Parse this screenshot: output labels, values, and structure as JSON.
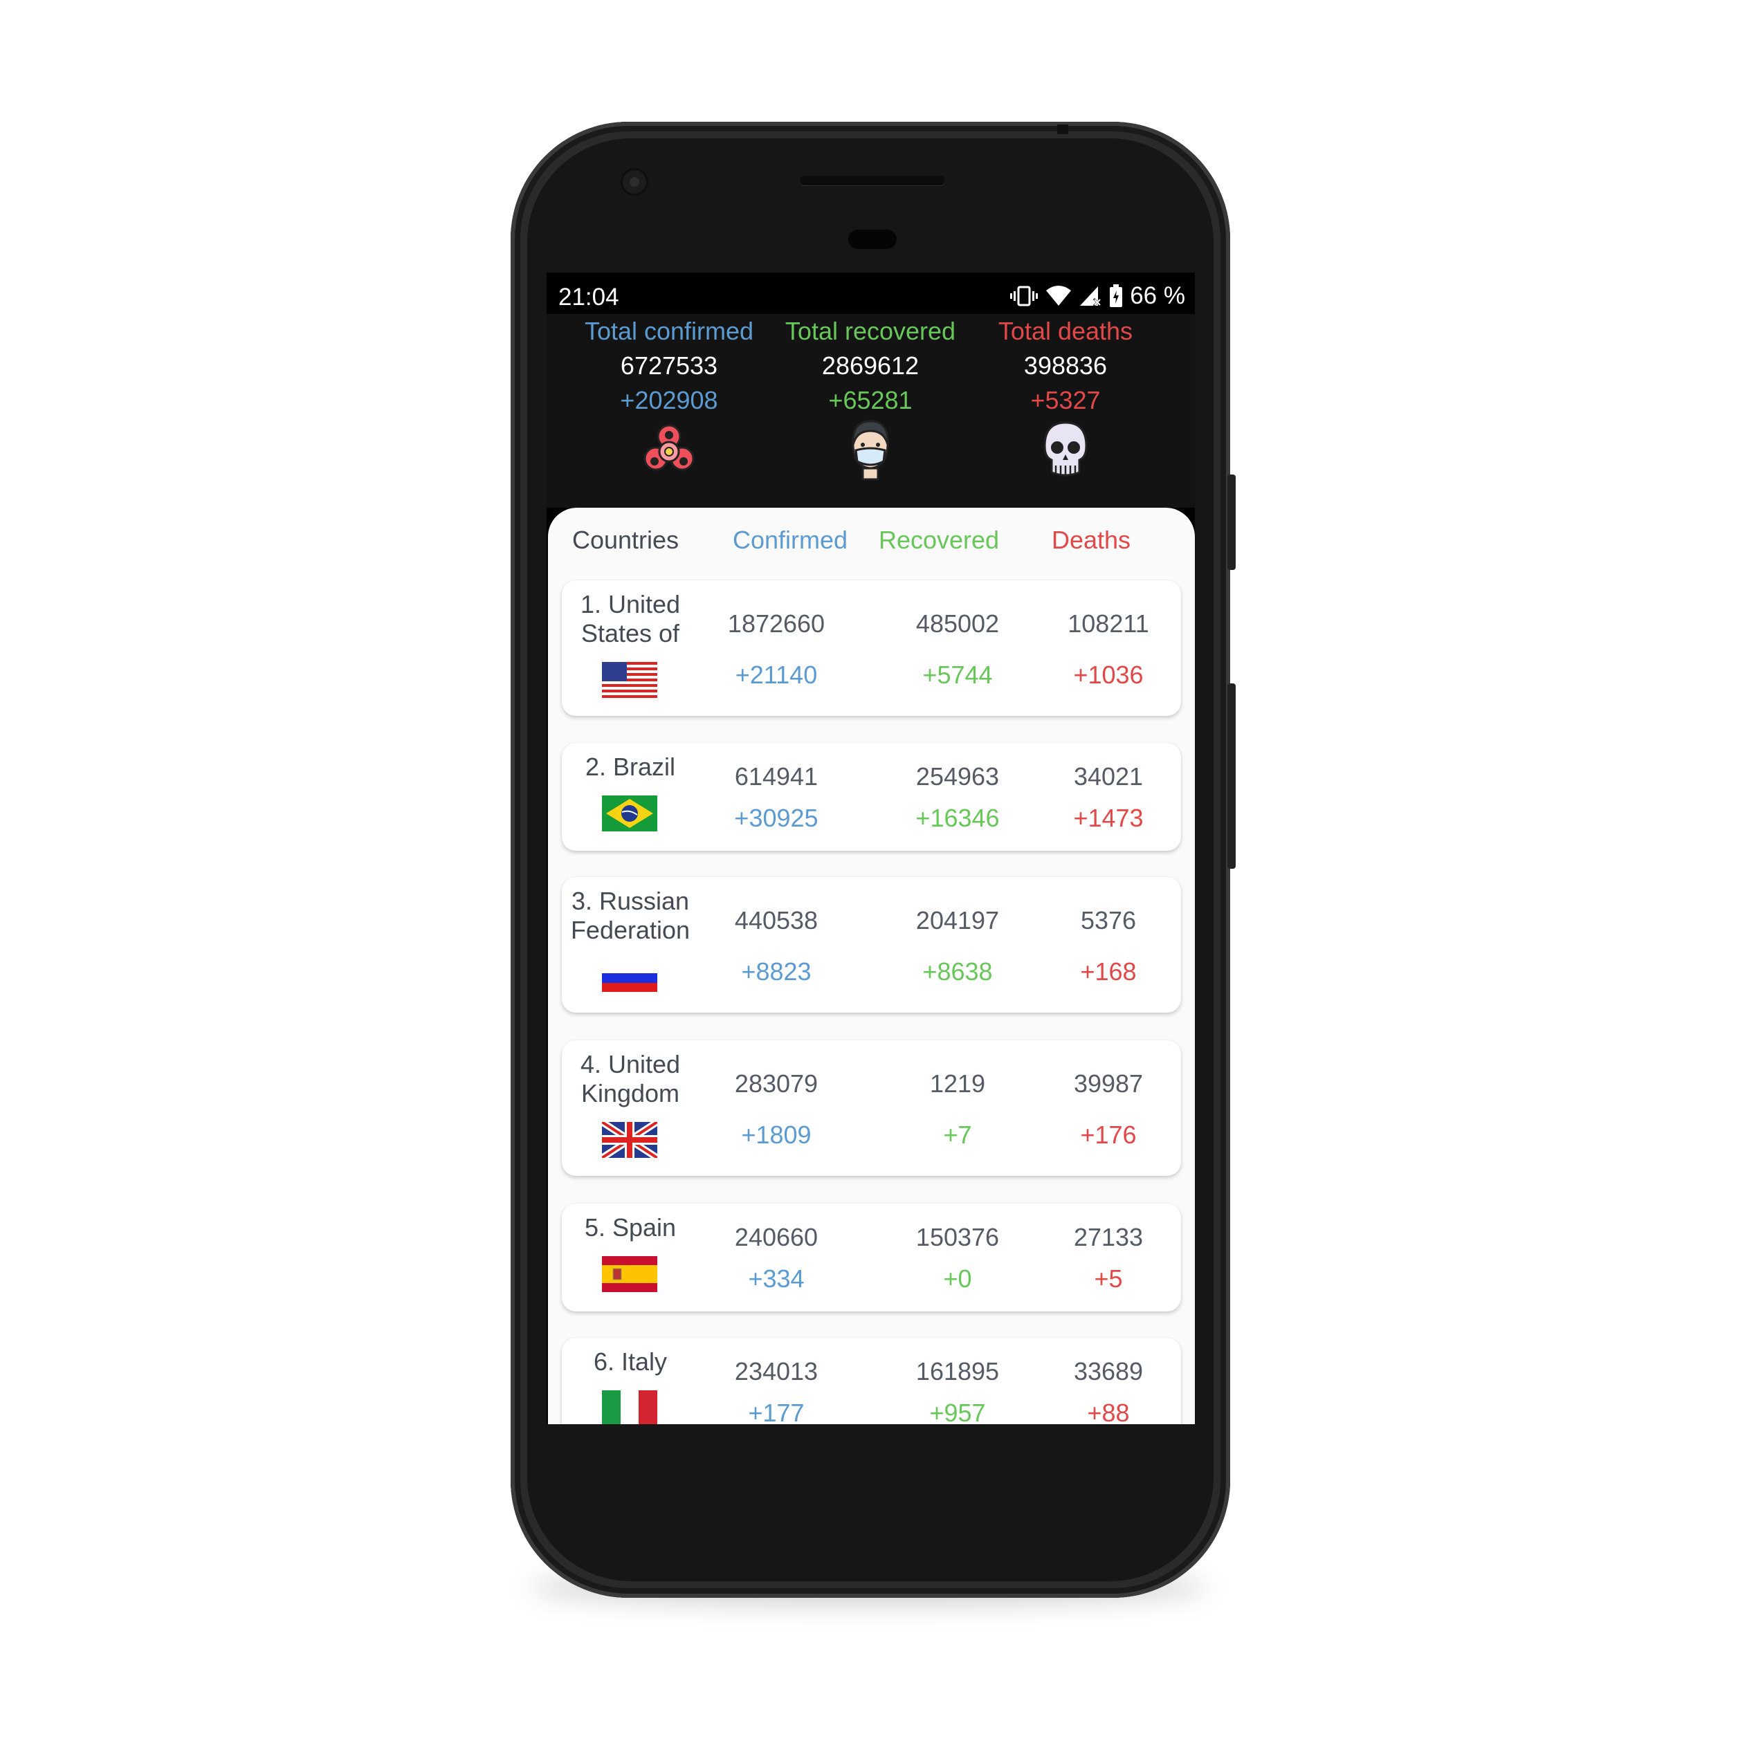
{
  "colors": {
    "confirmed": "#5c9bd1",
    "recovered": "#67c759",
    "deaths": "#e34848",
    "text": "#555b64"
  },
  "status_bar": {
    "time": "21:04",
    "battery": "66 %",
    "icons": [
      "vibrate-icon",
      "wifi-icon",
      "signal-icon",
      "battery-icon"
    ]
  },
  "summary": {
    "confirmed": {
      "label": "Total confirmed",
      "value": "6727533",
      "delta": "+202908",
      "icon": "biohazard-icon"
    },
    "recovered": {
      "label": "Total recovered",
      "value": "2869612",
      "delta": "+65281",
      "icon": "masked-person-icon"
    },
    "deaths": {
      "label": "Total deaths",
      "value": "398836",
      "delta": "+5327",
      "icon": "skull-icon"
    }
  },
  "table": {
    "headers": {
      "countries": "Countries",
      "confirmed": "Confirmed",
      "recovered": "Recovered",
      "deaths": "Deaths"
    },
    "rows": [
      {
        "name_l1": "1. United",
        "name_l2": "States of",
        "flag": "us-flag-icon",
        "confirmed": "1872660",
        "confirmed_delta": "+21140",
        "recovered": "485002",
        "recovered_delta": "+5744",
        "deaths": "108211",
        "deaths_delta": "+1036"
      },
      {
        "name_l1": "2. Brazil",
        "name_l2": "",
        "flag": "brazil-flag-icon",
        "confirmed": "614941",
        "confirmed_delta": "+30925",
        "recovered": "254963",
        "recovered_delta": "+16346",
        "deaths": "34021",
        "deaths_delta": "+1473"
      },
      {
        "name_l1": "3. Russian",
        "name_l2": "Federation",
        "flag": "russia-flag-icon",
        "confirmed": "440538",
        "confirmed_delta": "+8823",
        "recovered": "204197",
        "recovered_delta": "+8638",
        "deaths": "5376",
        "deaths_delta": "+168"
      },
      {
        "name_l1": "4. United",
        "name_l2": "Kingdom",
        "flag": "uk-flag-icon",
        "confirmed": "283079",
        "confirmed_delta": "+1809",
        "recovered": "1219",
        "recovered_delta": "+7",
        "deaths": "39987",
        "deaths_delta": "+176"
      },
      {
        "name_l1": "5. Spain",
        "name_l2": "",
        "flag": "spain-flag-icon",
        "confirmed": "240660",
        "confirmed_delta": "+334",
        "recovered": "150376",
        "recovered_delta": "+0",
        "deaths": "27133",
        "deaths_delta": "+5"
      },
      {
        "name_l1": "6. Italy",
        "name_l2": "",
        "flag": "italy-flag-icon",
        "confirmed": "234013",
        "confirmed_delta": "+177",
        "recovered": "161895",
        "recovered_delta": "+957",
        "deaths": "33689",
        "deaths_delta": "+88"
      }
    ]
  }
}
